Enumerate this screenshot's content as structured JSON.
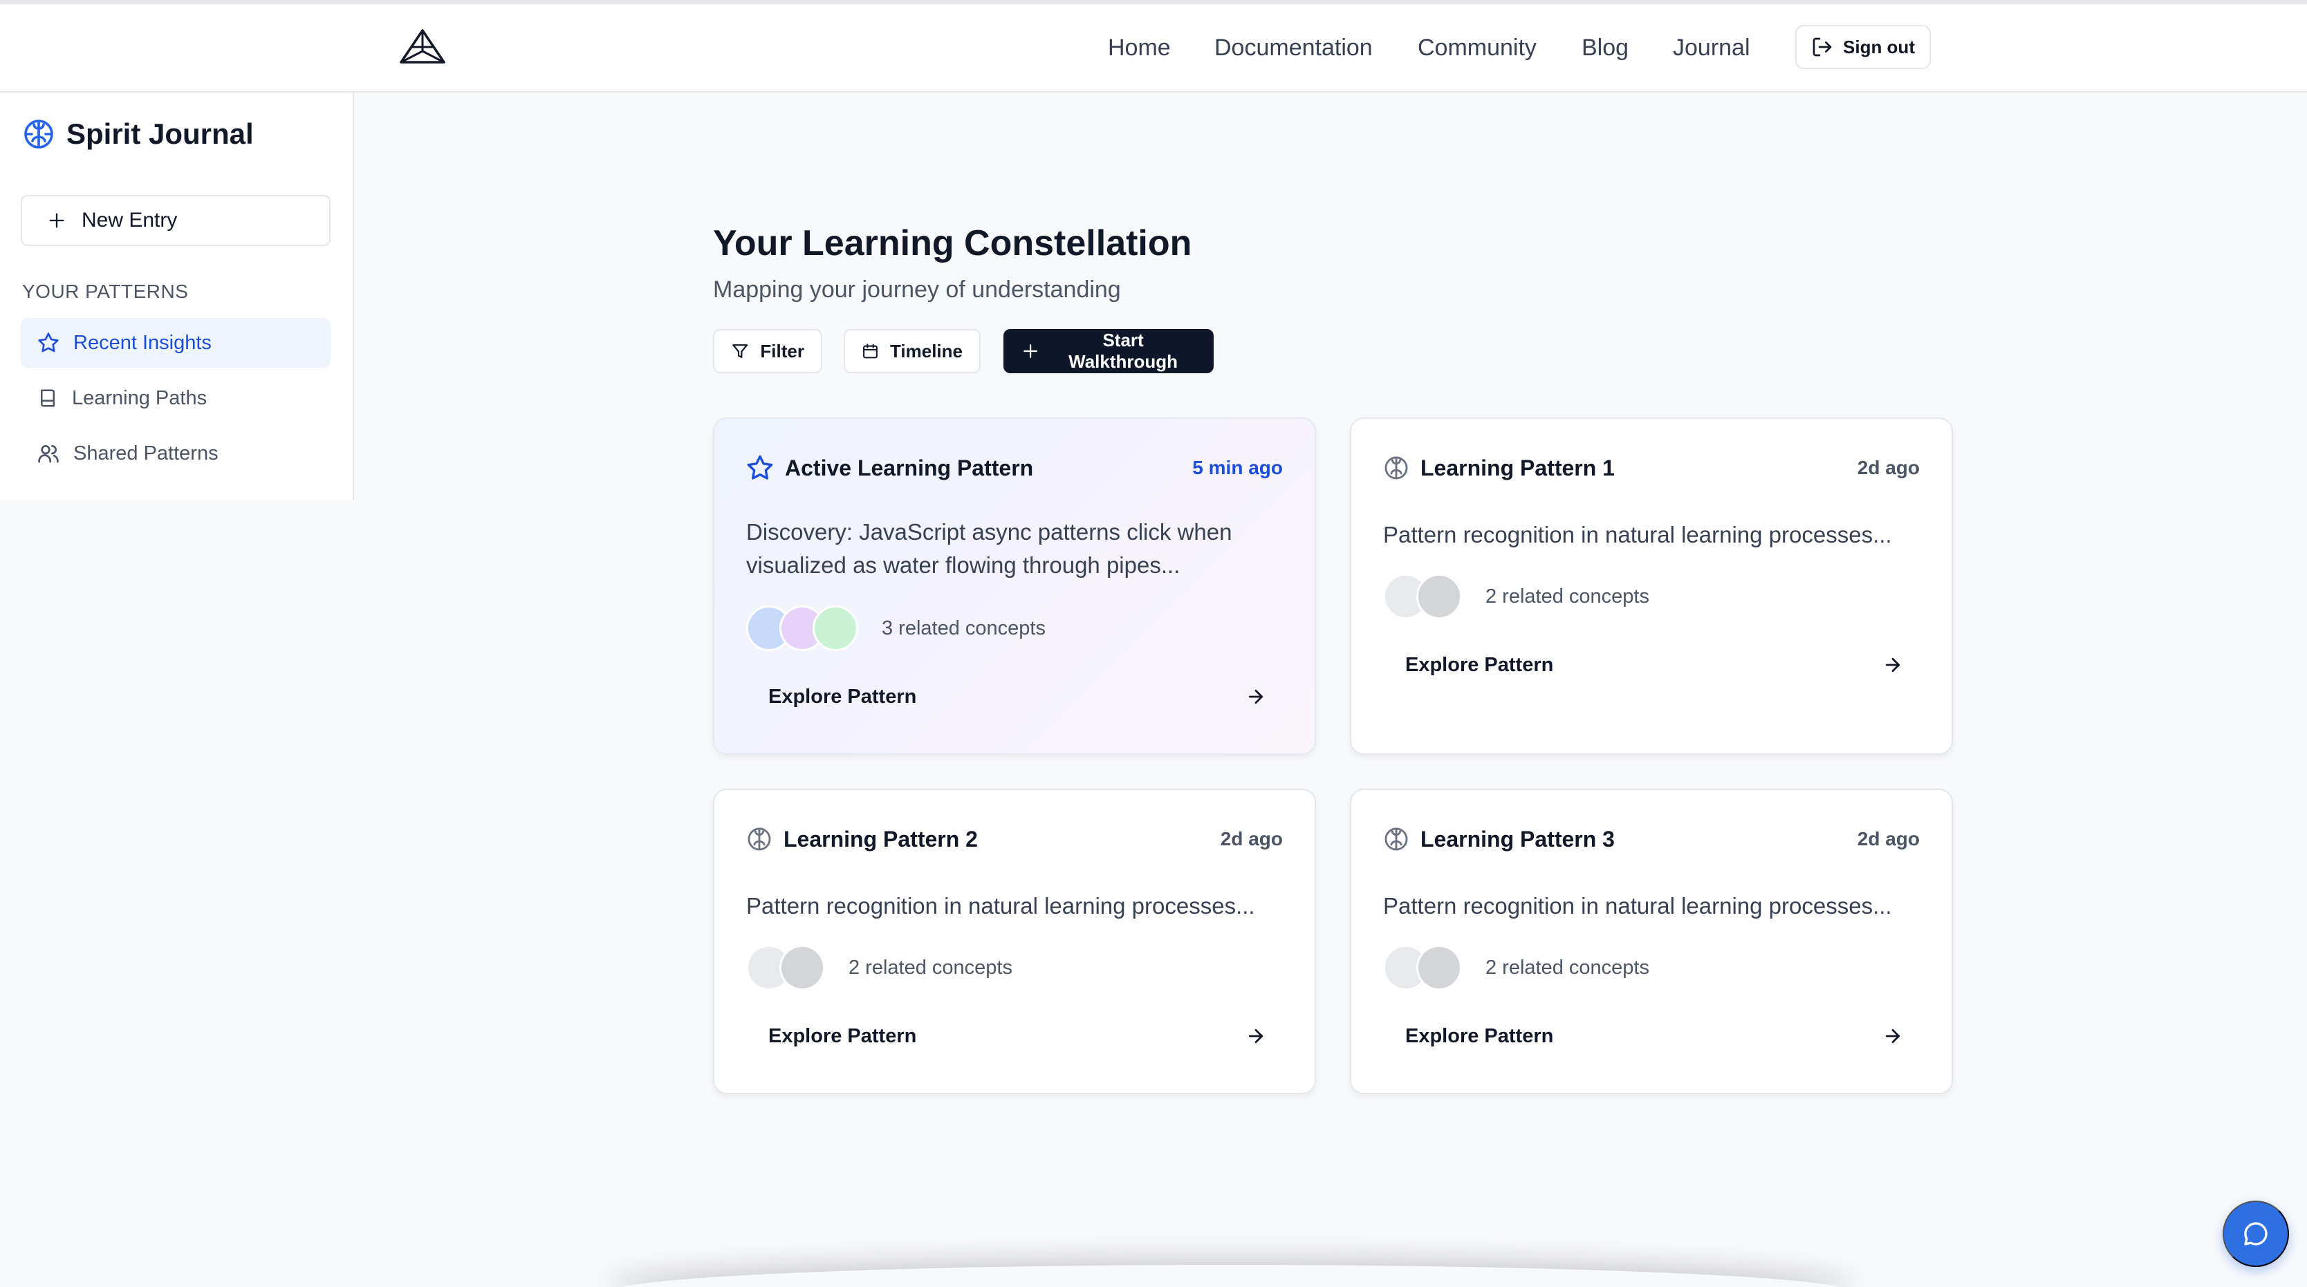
{
  "nav": {
    "links": [
      "Home",
      "Documentation",
      "Community",
      "Blog",
      "Journal"
    ],
    "signout_label": "Sign out"
  },
  "sidebar": {
    "title": "Spirit Journal",
    "new_entry_label": "New Entry",
    "section_label": "YOUR PATTERNS",
    "items": [
      {
        "label": "Recent Insights",
        "icon": "star-icon",
        "active": true
      },
      {
        "label": "Learning Paths",
        "icon": "book-icon",
        "active": false
      },
      {
        "label": "Shared Patterns",
        "icon": "users-icon",
        "active": false
      }
    ]
  },
  "main": {
    "title": "Your Learning Constellation",
    "subtitle": "Mapping your journey of understanding",
    "toolbar": {
      "filter_label": "Filter",
      "timeline_label": "Timeline",
      "walkthrough_label": "Start Walkthrough"
    },
    "cards": [
      {
        "title": "Active Learning Pattern",
        "time": "5 min ago",
        "body": "Discovery: JavaScript async patterns click when visualized as water flowing through pipes...",
        "concepts": "3 related concepts",
        "explore_label": "Explore Pattern",
        "dot_colors": [
          "#c7dafb",
          "#e6d2f8",
          "#c9f2d4"
        ]
      },
      {
        "title": "Learning Pattern 1",
        "time": "2d ago",
        "body": "Pattern recognition in natural learning processes...",
        "concepts": "2 related concepts",
        "explore_label": "Explore Pattern",
        "dot_colors": [
          "#e8e9ec",
          "#d4d5d9"
        ]
      },
      {
        "title": "Learning Pattern 2",
        "time": "2d ago",
        "body": "Pattern recognition in natural learning processes...",
        "concepts": "2 related concepts",
        "explore_label": "Explore Pattern",
        "dot_colors": [
          "#e8e9ec",
          "#d4d5d9"
        ]
      },
      {
        "title": "Learning Pattern 3",
        "time": "2d ago",
        "body": "Pattern recognition in natural learning processes...",
        "concepts": "2 related concepts",
        "explore_label": "Explore Pattern",
        "dot_colors": [
          "#e8e9ec",
          "#d4d5d9"
        ]
      }
    ]
  },
  "colors": {
    "accent": "#1d4ed8",
    "primary_button": "#0f172a",
    "fab": "#2f6fe4"
  }
}
